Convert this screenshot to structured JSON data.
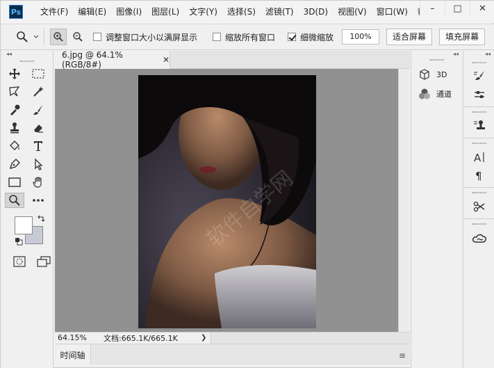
{
  "menubar": {
    "logo": "Ps",
    "items": [
      "文件(F)",
      "编辑(E)",
      "图像(I)",
      "图层(L)",
      "文字(Y)",
      "选择(S)",
      "滤镜(T)",
      "3D(D)",
      "视图(V)",
      "窗口(W)",
      "帮助"
    ],
    "window_buttons": [
      "–",
      "□",
      "✕"
    ]
  },
  "options": {
    "resize_windows_label": "调整窗口大小以满屏显示",
    "resize_windows_checked": false,
    "zoom_all_label": "缩放所有窗口",
    "zoom_all_checked": false,
    "scrubby_label": "细微缩放",
    "scrubby_checked": true,
    "zoom_value": "100%",
    "fit_screen": "适合屏幕",
    "fill_screen": "填充屏幕"
  },
  "document": {
    "tab_title": "6.jpg @ 64.1%(RGB/8#)",
    "close": "✕",
    "status_zoom": "64.15%",
    "status_doc": "文档:665.1K/665.1K",
    "status_arrow": "❯"
  },
  "timeline": {
    "tab_label": "时间轴"
  },
  "panels": {
    "items": [
      {
        "label": "3D",
        "icon": "cube-icon"
      },
      {
        "label": "通道",
        "icon": "channels-icon"
      }
    ]
  },
  "colors": {
    "foreground": "#ffffff",
    "background": "#c7cbd6",
    "canvas_bg": "#919191"
  }
}
